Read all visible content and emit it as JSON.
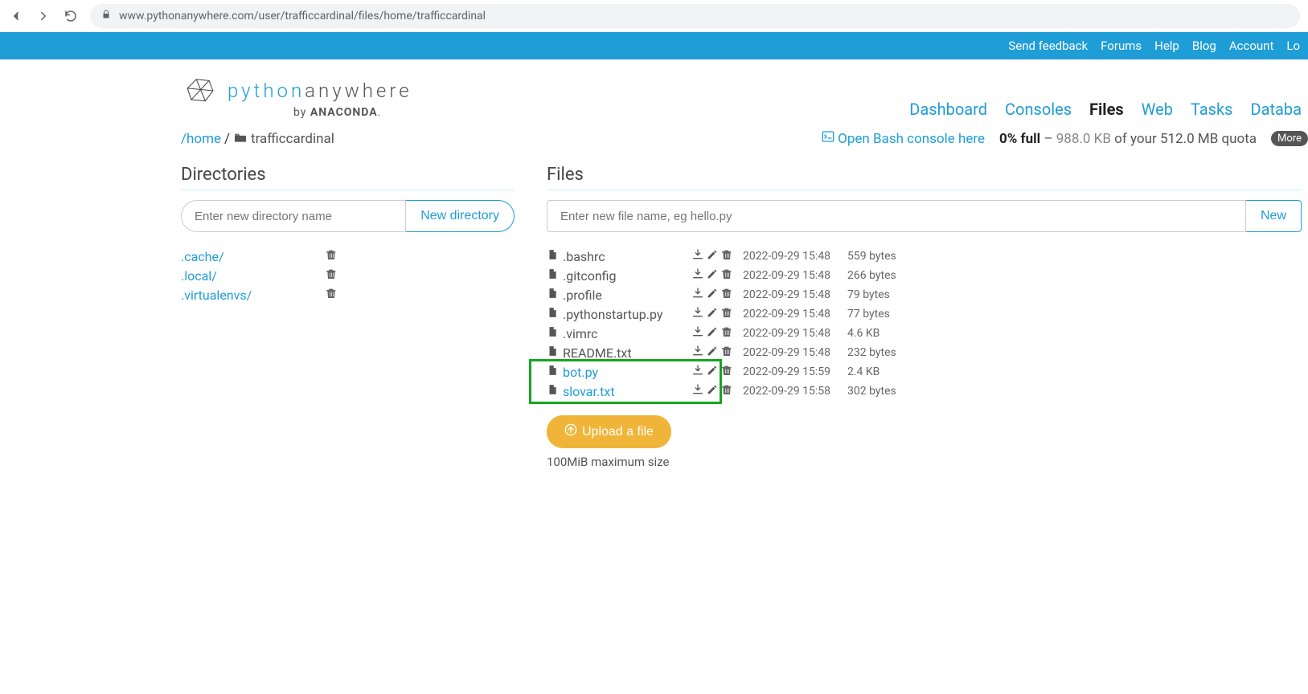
{
  "browser": {
    "url": "www.pythonanywhere.com/user/trafficcardinal/files/home/trafficcardinal"
  },
  "topbar": {
    "feedback": "Send feedback",
    "forums": "Forums",
    "help": "Help",
    "blog": "Blog",
    "account": "Account",
    "logout": "Lo"
  },
  "logo": {
    "python": "python",
    "anywhere": "anywhere",
    "by": "by ",
    "brand": "ANACONDA"
  },
  "mainnav": {
    "dashboard": "Dashboard",
    "consoles": "Consoles",
    "files": "Files",
    "web": "Web",
    "tasks": "Tasks",
    "databases": "Databa"
  },
  "breadcrumb": {
    "home": "/home",
    "sep": "/",
    "current": "trafficcardinal"
  },
  "bash": "Open Bash console here",
  "quota": {
    "pct": "0% full",
    "dash": " – ",
    "used": "988.0 KB",
    "rest": " of your 512.0 MB quota ",
    "more": "More"
  },
  "dirs": {
    "heading": "Directories",
    "placeholder": "Enter new directory name",
    "button": "New directory",
    "items": [
      {
        "name": ".cache/"
      },
      {
        "name": ".local/"
      },
      {
        "name": ".virtualenvs/"
      }
    ]
  },
  "files": {
    "heading": "Files",
    "placeholder": "Enter new file name, eg hello.py",
    "button": "New",
    "items": [
      {
        "name": ".bashrc",
        "ts": "2022-09-29 15:48",
        "size": "559 bytes",
        "link": false,
        "hl": false
      },
      {
        "name": ".gitconfig",
        "ts": "2022-09-29 15:48",
        "size": "266 bytes",
        "link": false,
        "hl": false
      },
      {
        "name": ".profile",
        "ts": "2022-09-29 15:48",
        "size": "79 bytes",
        "link": false,
        "hl": false
      },
      {
        "name": ".pythonstartup.py",
        "ts": "2022-09-29 15:48",
        "size": "77 bytes",
        "link": false,
        "hl": false
      },
      {
        "name": ".vimrc",
        "ts": "2022-09-29 15:48",
        "size": "4.6 KB",
        "link": false,
        "hl": false
      },
      {
        "name": "README.txt",
        "ts": "2022-09-29 15:48",
        "size": "232 bytes",
        "link": false,
        "hl": false
      },
      {
        "name": "bot.py",
        "ts": "2022-09-29 15:59",
        "size": "2.4 KB",
        "link": true,
        "hl": true
      },
      {
        "name": "slovar.txt",
        "ts": "2022-09-29 15:58",
        "size": "302 bytes",
        "link": true,
        "hl": true
      }
    ],
    "upload": "Upload a file",
    "upload_note": "100MiB maximum size"
  }
}
